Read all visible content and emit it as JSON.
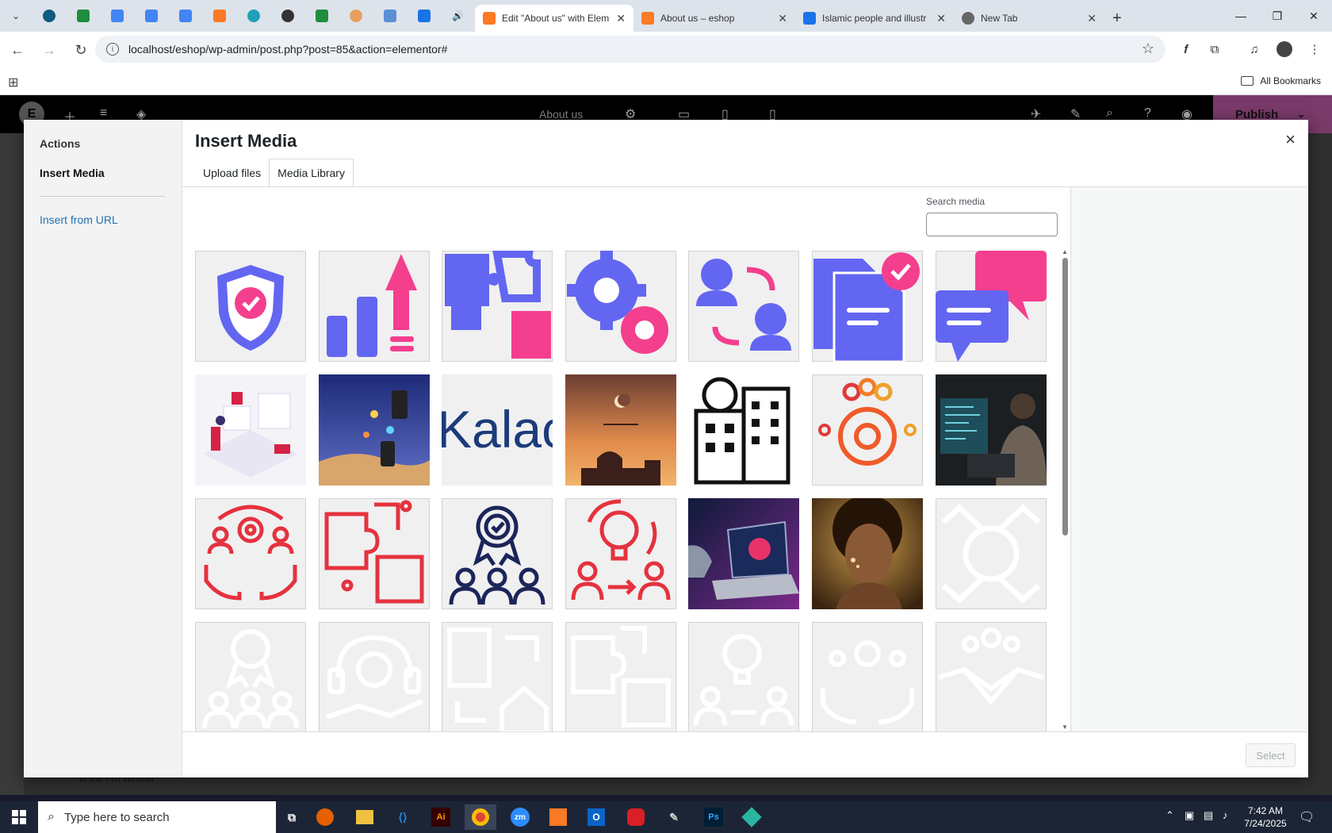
{
  "browser": {
    "tabs": [
      {
        "title": "Edit \"About us\" with Elem",
        "active": true
      },
      {
        "title": "About us – eshop",
        "active": false
      },
      {
        "title": "Islamic people and illustr",
        "active": false
      },
      {
        "title": "New Tab",
        "active": false
      }
    ],
    "url": "localhost/eshop/wp-admin/post.php?post=85&action=elementor#",
    "all_bookmarks": "All Bookmarks"
  },
  "elementor": {
    "page_name": "About us",
    "publish_label": "Publish",
    "backdrop_text": "in the Pro version"
  },
  "modal": {
    "sidebar_heading": "Actions",
    "sidebar_active": "Insert Media",
    "sidebar_link": "Insert from URL",
    "title": "Insert Media",
    "close": "×",
    "tabs": [
      "Upload files",
      "Media Library"
    ],
    "search_label": "Search media",
    "search_value": "",
    "select_label": "Select",
    "attachments": [
      "shield-check",
      "growth-chart",
      "puzzle-pieces",
      "gears",
      "user-exchange",
      "document-approved",
      "chat-bubbles",
      "security-isometric",
      "mobile-payments",
      "kala-logo",
      "ramadan-kareem",
      "discount-building",
      "team-gear",
      "developer-photo",
      "hands-gear-team",
      "puzzle-red",
      "award-team",
      "idea-team",
      "robot-laptop",
      "woman-portrait",
      "hands-circle-faded",
      "award-team-faded",
      "headset-gear-faded",
      "building-home-faded",
      "puzzle-faded",
      "idea-team-faded",
      "hands-team-faded",
      "handshake-faded"
    ]
  },
  "taskbar": {
    "search_placeholder": "Type here to search",
    "time": "7:42 AM",
    "date": "7/24/2025"
  }
}
